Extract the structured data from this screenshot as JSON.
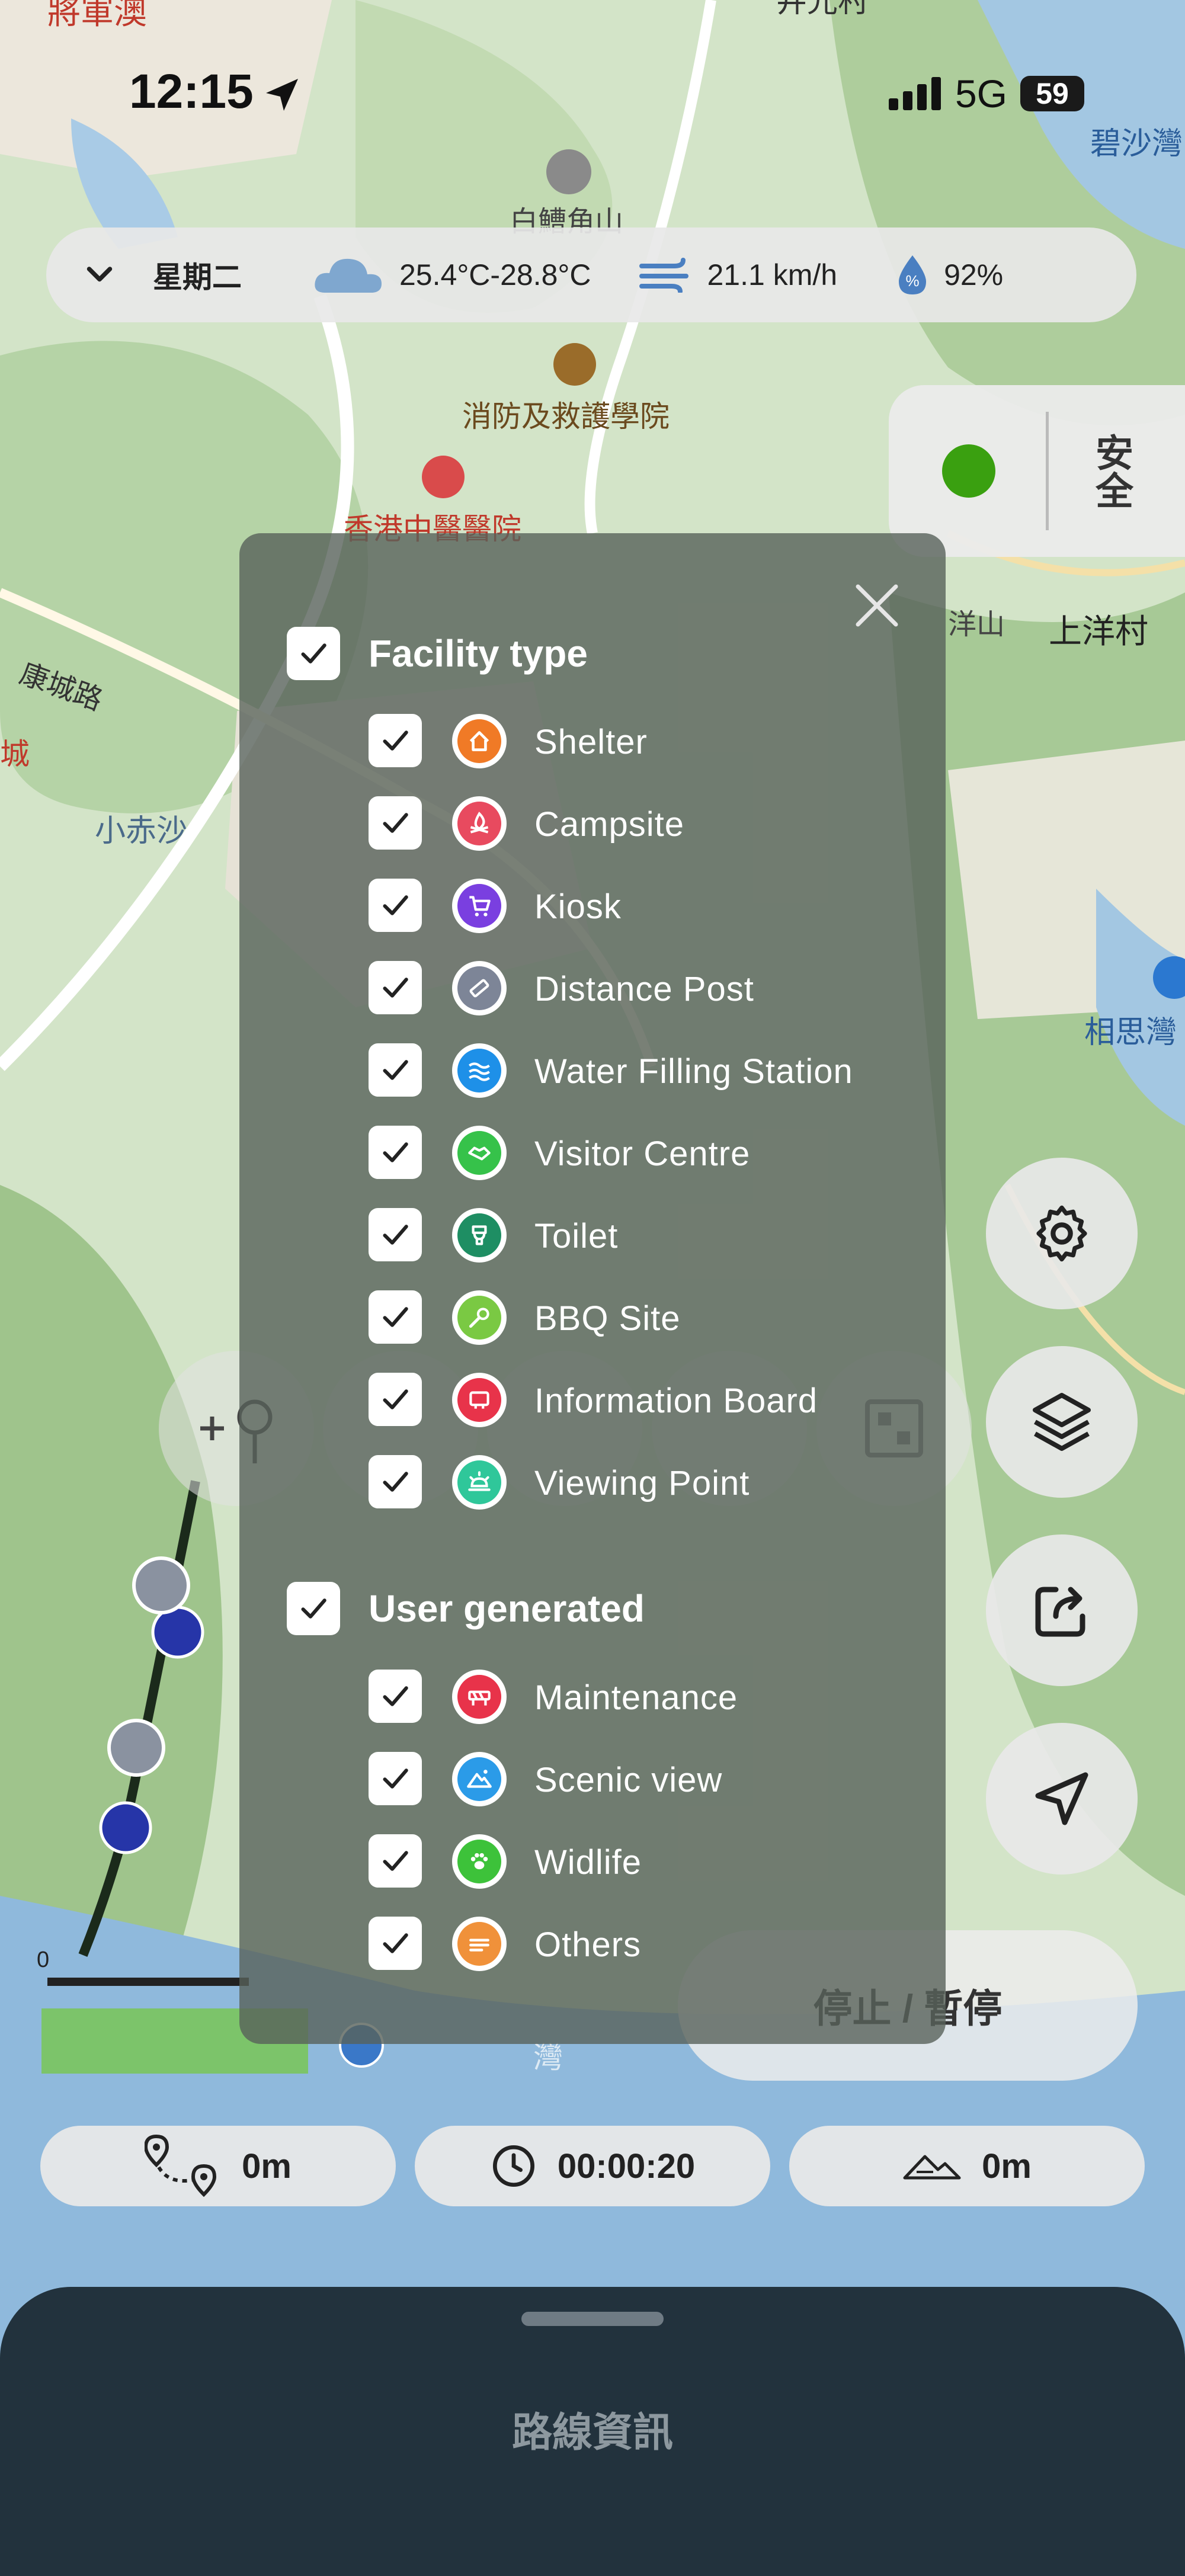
{
  "status_bar": {
    "time": "12:15",
    "network": "5G",
    "battery": "59"
  },
  "map_labels": {
    "top_left": "將軍澳",
    "top_center": "井光村",
    "peak": "白鰽角山",
    "academy": "消防及救護學院",
    "hospital": "香港中醫醫院",
    "road": "康城路",
    "beach": "小赤沙",
    "village": "上洋村",
    "bay_top": "碧沙灣",
    "bay_mid": "相思灣",
    "hill": "洋山",
    "side_left": "城",
    "scale_zero": "0",
    "bay_bottom": "灣"
  },
  "weather": {
    "day": "星期二",
    "temperature": "25.4°C-28.8°C",
    "wind": "21.1 km/h",
    "humidity": "92%"
  },
  "safety": {
    "label": "安全",
    "status_color": "#3aa010"
  },
  "filter_panel": {
    "facility_title": "Facility type",
    "facility_items": [
      {
        "label": "Shelter",
        "color": "#f07a26",
        "icon": "house-icon"
      },
      {
        "label": "Campsite",
        "color": "#e84a5f",
        "icon": "campfire-icon"
      },
      {
        "label": "Kiosk",
        "color": "#7a3fe0",
        "icon": "cart-icon"
      },
      {
        "label": "Distance Post",
        "color": "#7d8597",
        "icon": "distance-post-icon"
      },
      {
        "label": "Water Filling Station",
        "color": "#1e90e8",
        "icon": "water-waves-icon"
      },
      {
        "label": "Visitor Centre",
        "color": "#36c24a",
        "icon": "handshake-icon"
      },
      {
        "label": "Toilet",
        "color": "#1e8e63",
        "icon": "toilet-icon"
      },
      {
        "label": "BBQ Site",
        "color": "#7ac943",
        "icon": "bbq-fork-icon"
      },
      {
        "label": "Information Board",
        "color": "#e8334a",
        "icon": "info-board-icon"
      },
      {
        "label": "Viewing Point",
        "color": "#2fc79a",
        "icon": "sunrise-icon"
      }
    ],
    "user_title": "User generated",
    "user_items": [
      {
        "label": "Maintenance",
        "color": "#e8334a",
        "icon": "barrier-icon"
      },
      {
        "label": "Scenic view",
        "color": "#2b9be8",
        "icon": "mountain-icon"
      },
      {
        "label": "Widlife",
        "color": "#3dc23a",
        "icon": "paw-icon"
      },
      {
        "label": "Others",
        "color": "#f0913a",
        "icon": "others-icon"
      }
    ]
  },
  "controls": {
    "stop_pause": "停止 / 暫停"
  },
  "stats": {
    "distance": "0m",
    "elapsed": "00:00:20",
    "elevation": "0m"
  },
  "bottom_sheet": {
    "title": "路線資訊"
  }
}
